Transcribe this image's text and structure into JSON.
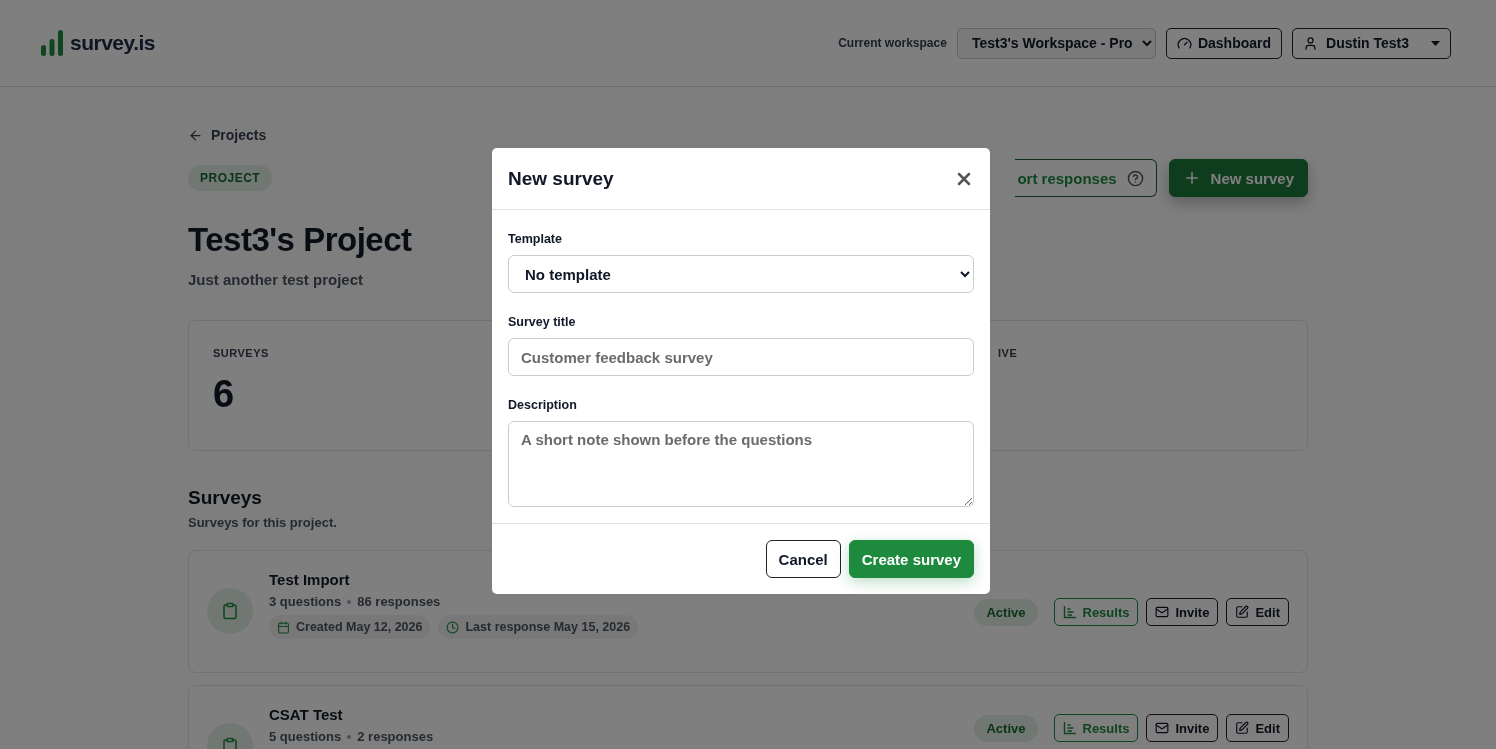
{
  "header": {
    "logo": "survey.is",
    "workspace_label": "Current workspace",
    "workspace_select": "Test3's Workspace - Pro",
    "dashboard_button": "Dashboard",
    "user_menu": "Dustin Test3"
  },
  "page": {
    "back_link": "Projects",
    "badge": "PROJECT",
    "title": "Test3's Project",
    "subtitle": "Just another test project",
    "actions": [
      {
        "kind": "outline",
        "label": "ort responses"
      },
      {
        "kind": "primary",
        "label": "New survey"
      }
    ],
    "stats": [
      {
        "label": "SURVEYS",
        "value": "6"
      },
      {
        "label": "IVE"
      }
    ]
  },
  "surveys": {
    "heading": "Surveys",
    "subheading": "Surveys for this project.",
    "rows": [
      {
        "title": "Test Import",
        "questions": "3 questions",
        "responses": "86 responses",
        "created": "Created May 12, 2026",
        "last_response": "Last response May 15, 2026",
        "status": "Active",
        "buttons": [
          "Results",
          "Invite",
          "Edit"
        ]
      },
      {
        "title": "CSAT Test",
        "questions": "5 questions",
        "responses": "2 responses",
        "status": "Active",
        "buttons": [
          "Results",
          "Invite",
          "Edit"
        ]
      }
    ]
  },
  "modal": {
    "title": "New survey",
    "fields": [
      {
        "kind": "select",
        "label": "Template",
        "value": "No template"
      },
      {
        "kind": "input",
        "label": "Survey title",
        "placeholder": "Customer feedback survey"
      },
      {
        "kind": "textarea",
        "label": "Description",
        "placeholder": "A short note shown before the questions"
      }
    ],
    "buttons": [
      {
        "kind": "secondary",
        "label": "Cancel"
      },
      {
        "kind": "primary",
        "label": "Create survey"
      }
    ]
  }
}
